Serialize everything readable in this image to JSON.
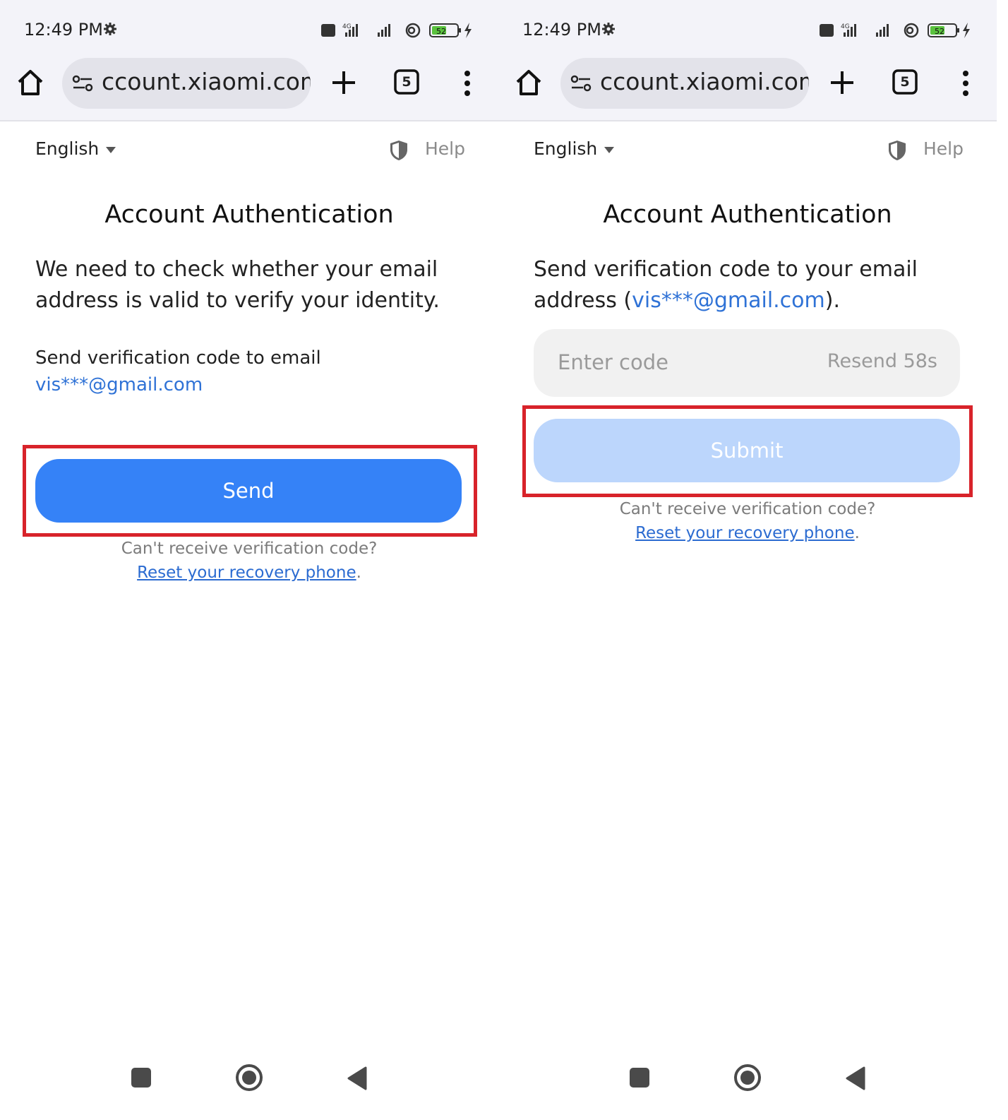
{
  "colors": {
    "accent": "#3582f7",
    "accent_disabled": "#bcd6fc",
    "link": "#2b6bd1",
    "highlight_border": "#d8232a",
    "chrome_bg": "#f3f3f9"
  },
  "status_bar": {
    "time": "12:49 PM",
    "battery": "52",
    "network": "4G"
  },
  "browser": {
    "url": "ccount.xiaomi.com",
    "tab_count": "5"
  },
  "left": {
    "language": "English",
    "help": "Help",
    "title": "Account Authentication",
    "intro": "We need to check whether your email address is valid to verify your identity.",
    "send_info_prefix": "Send verification code to email ",
    "email": "vis***@gmail.com",
    "send_button": "Send",
    "cant_receive": "Can't receive verification code?",
    "reset_link": "Reset your recovery phone",
    "reset_suffix": "."
  },
  "right": {
    "language": "English",
    "help": "Help",
    "title": "Account Authentication",
    "intro_prefix": "Send verification code to your email address (",
    "email": "vis***@gmail.com",
    "intro_suffix": ").",
    "code_placeholder": "Enter code",
    "resend": "Resend 58s",
    "submit_button": "Submit",
    "cant_receive": "Can't receive verification code?",
    "reset_link": "Reset your recovery phone",
    "reset_suffix": "."
  },
  "icons": [
    "gear-icon",
    "home-icon",
    "site-settings-icon",
    "plus-icon",
    "tabs-icon",
    "more-vert-icon",
    "caret-down-icon",
    "shield-icon",
    "recents-icon",
    "nav-home-icon",
    "back-icon"
  ]
}
